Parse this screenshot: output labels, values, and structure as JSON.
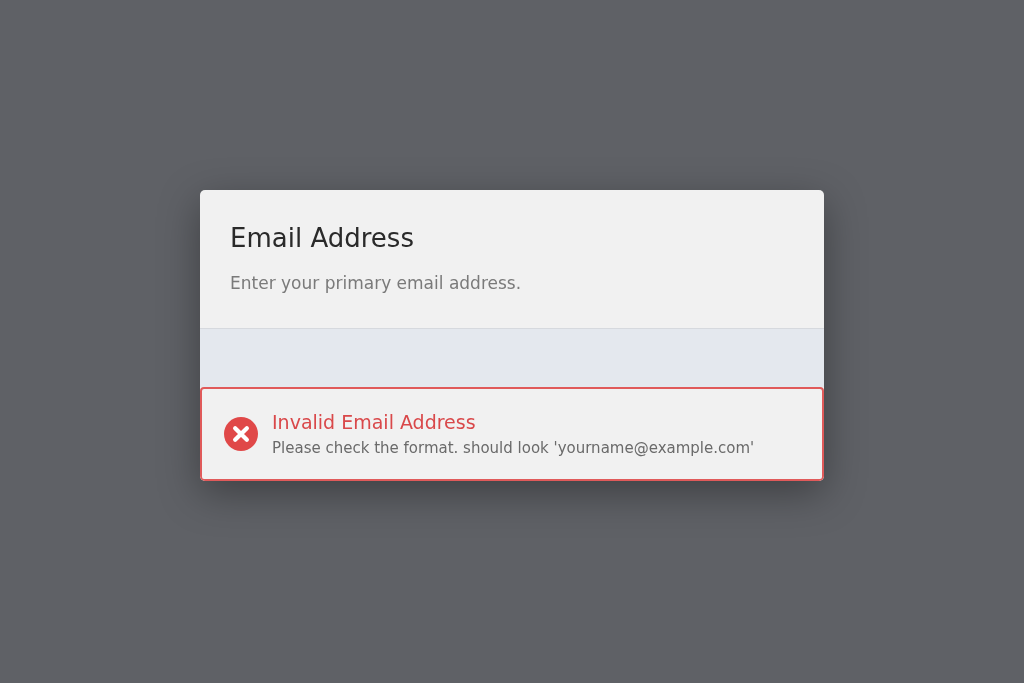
{
  "dialog": {
    "title": "Email Address",
    "description": "Enter your primary email address.",
    "message": {
      "kind": "error",
      "title": "Invalid Email Address",
      "text": "Please check the format. should look 'yourname@example.com'"
    }
  }
}
